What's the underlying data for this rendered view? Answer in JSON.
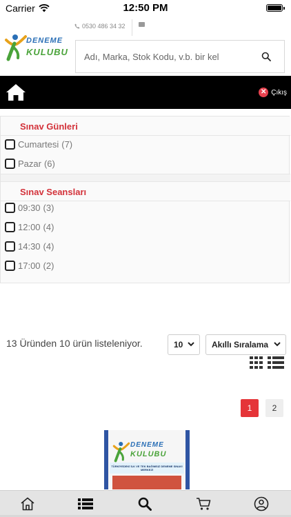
{
  "status_bar": {
    "carrier": "Carrier",
    "time": "12:50 PM"
  },
  "header": {
    "phone": "0530 486 34 32",
    "logo_line1": "DENEME",
    "logo_line2": "KULUBU",
    "search_placeholder": "Adı, Marka, Stok Kodu, v.b. bir kel"
  },
  "nav": {
    "logout_label": "Çıkış"
  },
  "filters": {
    "days": {
      "title": "Sınav Günleri",
      "options": [
        {
          "label": "Cumartesi",
          "count": "(7)"
        },
        {
          "label": "Pazar",
          "count": "(6)"
        }
      ]
    },
    "sessions": {
      "title": "Sınav Seansları",
      "options": [
        {
          "label": "09:30",
          "count": "(3)"
        },
        {
          "label": "12:00",
          "count": "(4)"
        },
        {
          "label": "14:30",
          "count": "(4)"
        },
        {
          "label": "17:00",
          "count": "(2)"
        }
      ]
    }
  },
  "listing": {
    "count_text": "13 Üründen 10 ürün listeleniyor.",
    "page_size": "10",
    "sort": "Akıllı Sıralama"
  },
  "pagination": {
    "pages": [
      "1",
      "2"
    ],
    "active": "1"
  },
  "banner": {
    "line1": "DENEME",
    "line2": "KULUBU",
    "tagline": "TÜRKİYEDEKİ İLK VE TEK BAĞIMSIZ DENEME SINAVI MERKEZİ"
  },
  "tabs": [
    "home-icon",
    "list-icon",
    "search-icon",
    "cart-icon",
    "user-icon"
  ],
  "colors": {
    "accent_red": "#d3323a",
    "nav_black": "#000000",
    "logo_blue": "#2a6fb6",
    "logo_green": "#4aa33a"
  }
}
